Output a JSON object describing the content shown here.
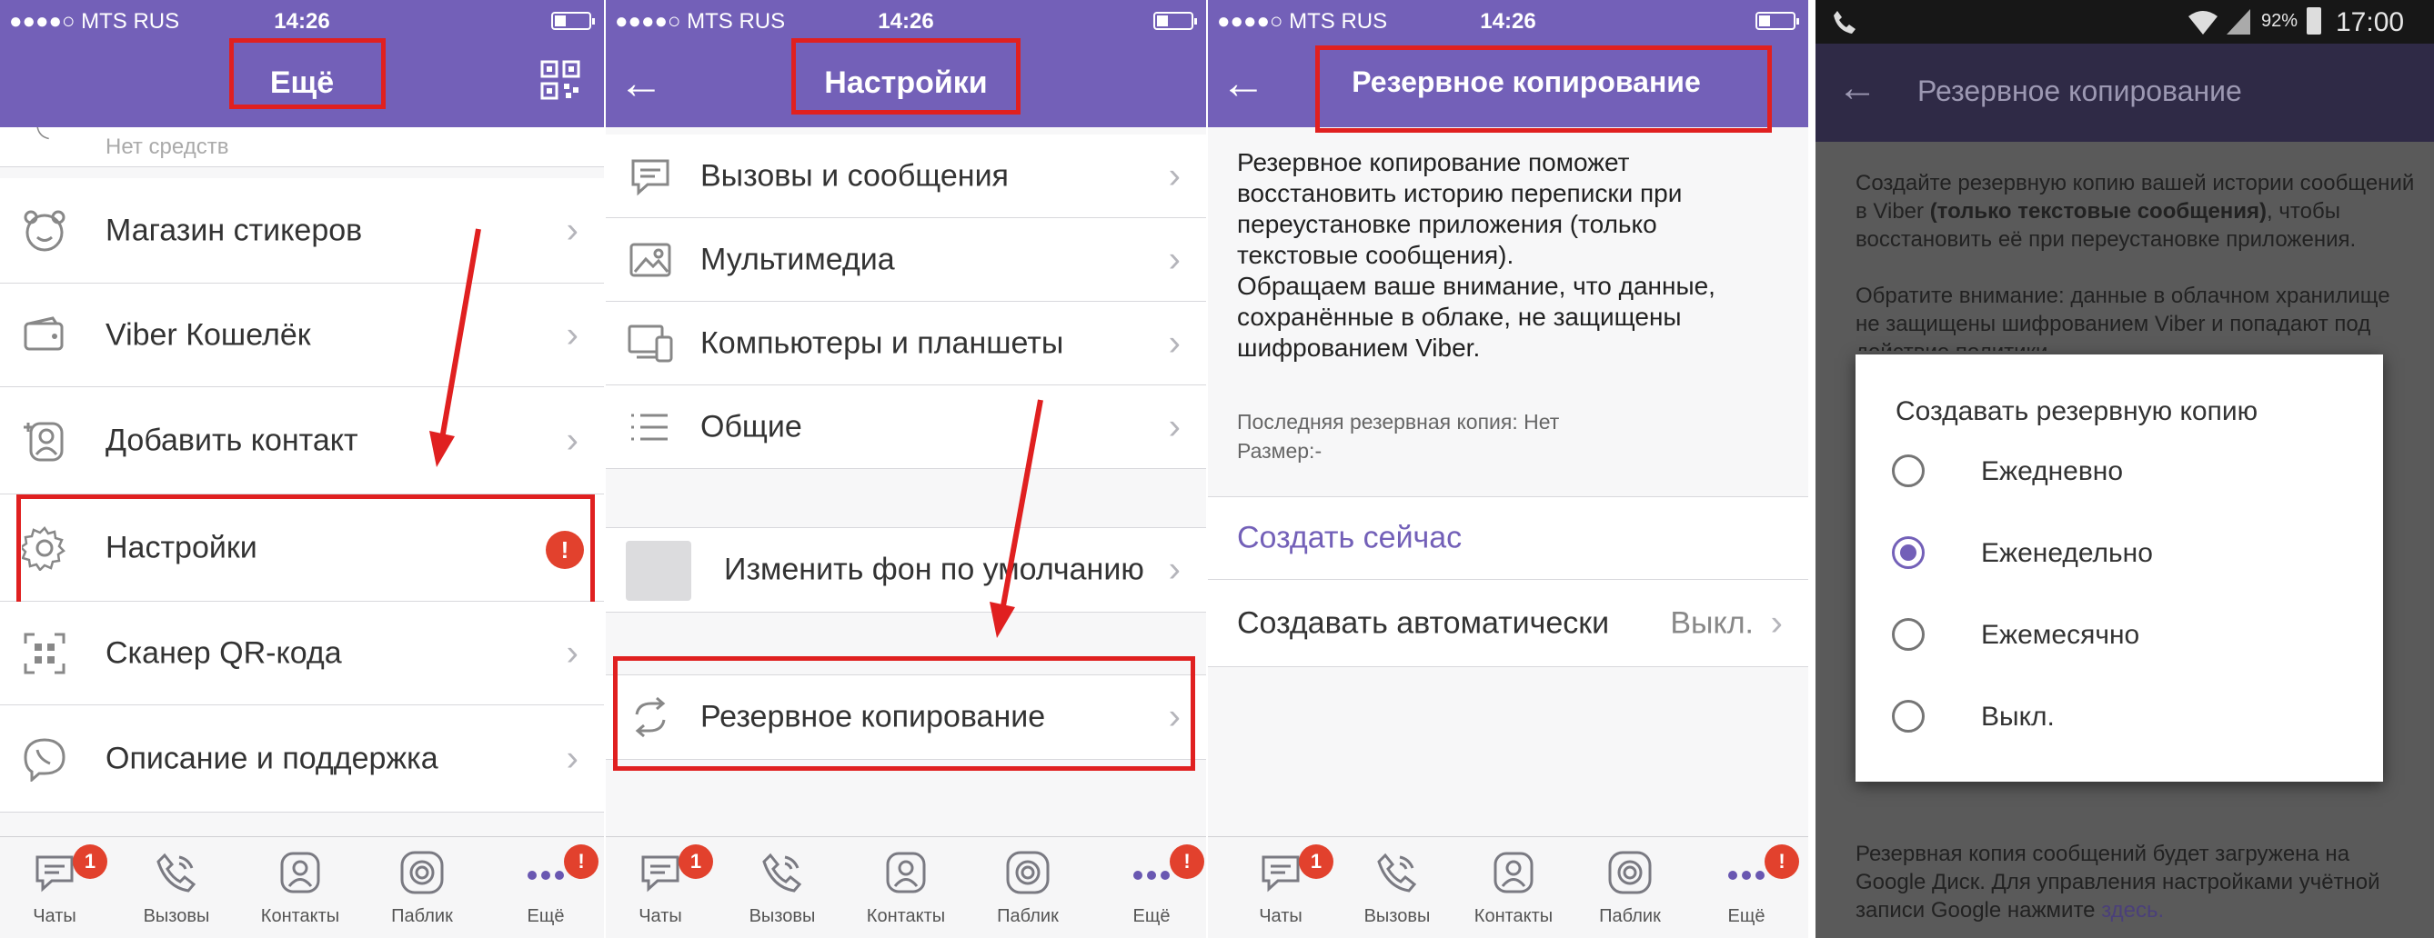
{
  "colors": {
    "viber_purple": "#7360b8",
    "highlight_red": "#e02020",
    "badge_red": "#e2412d"
  },
  "ios_status": {
    "carrier": "●●●●○ MTS RUS",
    "time": "14:26"
  },
  "panel1": {
    "title": "Ещё",
    "items": [
      {
        "label": "Нет средств",
        "icon": "phone-icon"
      },
      {
        "label": "Магазин стикеров",
        "icon": "sticker-bear-icon"
      },
      {
        "label": "Viber Кошелёк",
        "icon": "wallet-icon"
      },
      {
        "label": "Добавить контакт",
        "icon": "add-contact-icon"
      },
      {
        "label": "Настройки",
        "icon": "gear-icon",
        "badge": "!"
      },
      {
        "label": "Сканер QR-кода",
        "icon": "qr-icon"
      },
      {
        "label": "Описание и поддержка",
        "icon": "viber-logo-icon"
      }
    ]
  },
  "tabs": [
    {
      "label": "Чаты",
      "icon": "chat-icon",
      "badge": "1"
    },
    {
      "label": "Вызовы",
      "icon": "phone-icon"
    },
    {
      "label": "Контакты",
      "icon": "contact-icon"
    },
    {
      "label": "Паблик",
      "icon": "public-icon"
    },
    {
      "label": "Ещё",
      "icon": "more-dots-icon",
      "badge": "!"
    }
  ],
  "panel2": {
    "title": "Настройки",
    "items": [
      {
        "label": "Вызовы и сообщения",
        "icon": "message-icon"
      },
      {
        "label": "Мультимедиа",
        "icon": "image-icon"
      },
      {
        "label": "Компьютеры и планшеты",
        "icon": "devices-icon"
      },
      {
        "label": "Общие",
        "icon": "list-icon"
      }
    ],
    "background_item": "Изменить фон по умолчанию",
    "backup_item": "Резервное копирование"
  },
  "panel3": {
    "title": "Резервное копирование",
    "description": "Резервное копирование поможет\nвосстановить историю переписки при\nпереустановке приложения (только\nтекстовые сообщения).\nОбращаем ваше внимание, что данные,\nсохранённые в облаке, не защищены\nшифрованием Viber.",
    "last_backup": "Последняя резервная копия: Нет",
    "size": "Размер:-",
    "create_now": "Создать сейчас",
    "auto_label": "Создавать автоматически",
    "auto_value": "Выкл."
  },
  "panel4": {
    "status": {
      "battery": "92%",
      "time": "17:00"
    },
    "title": "Резервное копирование",
    "text_top_1": "Создайте резервную копию вашей истории сообщений в Viber",
    "text_top_bold": "(только текстовые сообщения)",
    "text_top_2": ", чтобы восстановить её при переустановке приложения.",
    "text_notice": "Обратите внимание: данные в облачном хранилище не защищены шифрованием Viber",
    "text_notice_cut": "и попадают под действие политики",
    "dialog": {
      "title": "Создавать резервную копию",
      "options": [
        {
          "label": "Ежедневно",
          "selected": false
        },
        {
          "label": "Еженедельно",
          "selected": true
        },
        {
          "label": "Ежемесячно",
          "selected": false
        },
        {
          "label": "Выкл.",
          "selected": false
        }
      ]
    },
    "text_bottom": "Резервная копия сообщений будет загружена на Google Диск. Для управления настройками учётной записи Google нажмите",
    "link": "здесь."
  }
}
